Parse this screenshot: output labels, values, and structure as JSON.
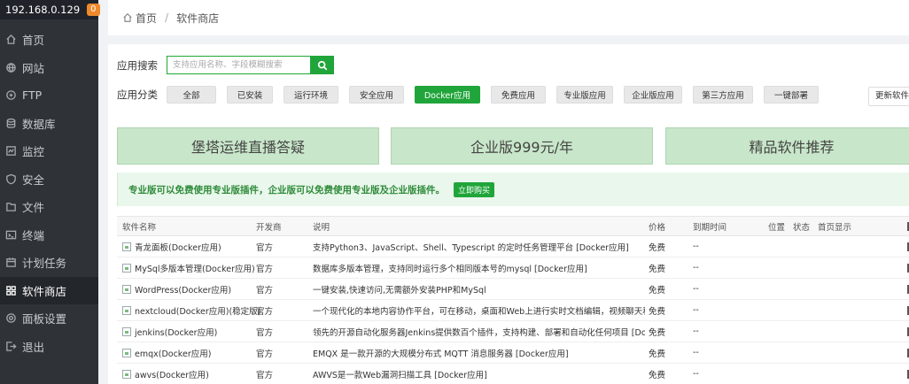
{
  "sidebar": {
    "ip": "192.168.0.129",
    "badge": "0",
    "items": [
      {
        "label": "首页",
        "icon": "home-icon"
      },
      {
        "label": "网站",
        "icon": "globe-icon"
      },
      {
        "label": "FTP",
        "icon": "ftp-icon"
      },
      {
        "label": "数据库",
        "icon": "database-icon"
      },
      {
        "label": "监控",
        "icon": "monitor-icon"
      },
      {
        "label": "安全",
        "icon": "shield-icon"
      },
      {
        "label": "文件",
        "icon": "folder-icon"
      },
      {
        "label": "终端",
        "icon": "terminal-icon"
      },
      {
        "label": "计划任务",
        "icon": "calendar-icon"
      },
      {
        "label": "软件商店",
        "icon": "grid-icon",
        "active": true
      },
      {
        "label": "面板设置",
        "icon": "settings-icon"
      },
      {
        "label": "退出",
        "icon": "logout-icon"
      }
    ]
  },
  "breadcrumb": {
    "home": "首页",
    "sep": "/",
    "current": "软件商店"
  },
  "search": {
    "label": "应用搜索",
    "placeholder": "支持应用名称、字段模糊搜索"
  },
  "categories": {
    "label": "应用分类",
    "items": [
      "全部",
      "已安装",
      "运行环境",
      "安全应用",
      "Docker应用",
      "免费应用",
      "专业版应用",
      "企业版应用",
      "第三方应用",
      "一键部署"
    ],
    "active": "Docker应用",
    "update": "更新软件列表"
  },
  "banners": [
    "堡塔运维直播答疑",
    "企业版999元/年",
    "精品软件推荐"
  ],
  "promo": {
    "text": "专业版可以免费使用专业版插件，企业版可以免费使用专业版及企业版插件。",
    "button": "立即购买"
  },
  "table": {
    "headers": {
      "name": "软件名称",
      "dev": "开发商",
      "desc": "说明",
      "price": "价格",
      "expire": "到期时间",
      "pos": "位置",
      "status": "状态",
      "home": "首页显示"
    },
    "rows": [
      {
        "name": "青龙面板(Docker应用)",
        "dev": "官方",
        "desc": "支持Python3、JavaScript、Shell、Typescript 的定时任务管理平台 [Docker应用]",
        "price": "免费",
        "expire": "--"
      },
      {
        "name": "MySql多版本管理(Docker应用)",
        "dev": "官方",
        "desc": "数据库多版本管理，支持同时运行多个相同版本号的mysql [Docker应用]",
        "price": "免费",
        "expire": "--"
      },
      {
        "name": "WordPress(Docker应用)",
        "dev": "官方",
        "desc": "一键安装,快速访问,无需额外安装PHP和MySql",
        "price": "免费",
        "expire": "--"
      },
      {
        "name": "nextcloud(Docker应用)(稳定版)",
        "dev": "官方",
        "desc": "一个现代化的本地内容协作平台，可在移动，桌面和Web上进行实时文档编辑，视频聊天和群件",
        "price": "免费",
        "expire": "--"
      },
      {
        "name": "jenkins(Docker应用)",
        "dev": "官方",
        "desc": "领先的开源自动化服务器Jenkins提供数百个插件，支持构建、部署和自动化任何项目 [Docker应用]",
        "price": "免费",
        "expire": "--"
      },
      {
        "name": "emqx(Docker应用)",
        "dev": "官方",
        "desc": "EMQX 是一款开源的大规模分布式 MQTT 消息服务器 [Docker应用]",
        "price": "免费",
        "expire": "--"
      },
      {
        "name": "awvs(Docker应用)",
        "dev": "官方",
        "desc": "AWVS是一款Web漏洞扫描工具 [Docker应用]",
        "price": "免费",
        "expire": "--"
      }
    ]
  },
  "colors": {
    "sidebar_bg": "#2f3337",
    "accent": "#20a53a",
    "banner_bg": "#c8e6c9",
    "badge": "#f0892b"
  }
}
